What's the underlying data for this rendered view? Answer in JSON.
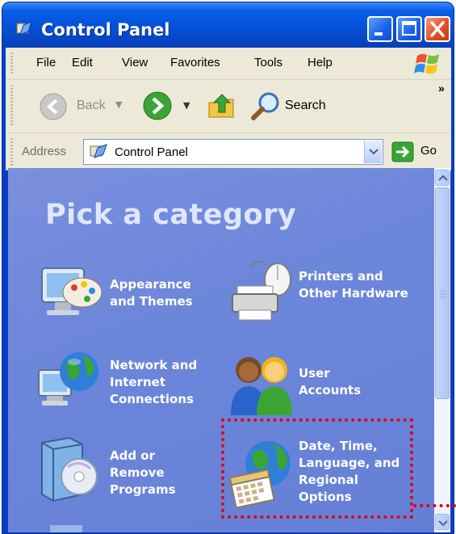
{
  "window": {
    "title": "Control Panel"
  },
  "menu": {
    "items": [
      {
        "label": "File"
      },
      {
        "label": "Edit"
      },
      {
        "label": "View"
      },
      {
        "label": "Favorites"
      },
      {
        "label": "Tools"
      },
      {
        "label": "Help"
      }
    ]
  },
  "toolbar": {
    "back_label": "Back",
    "search_label": "Search",
    "chevron": "»"
  },
  "address": {
    "label": "Address",
    "value": "Control Panel",
    "go_label": "Go"
  },
  "content": {
    "heading": "Pick a category",
    "categories": [
      {
        "label": "Appearance and Themes",
        "icon": "appearance-themes-icon"
      },
      {
        "label": "Printers and Other Hardware",
        "icon": "printer-icon"
      },
      {
        "label": "Network and Internet Connections",
        "icon": "network-globe-icon"
      },
      {
        "label": "User Accounts",
        "icon": "user-accounts-icon"
      },
      {
        "label": "Add or Remove Programs",
        "icon": "add-remove-programs-icon"
      },
      {
        "label": "Date, Time, Language, and Regional Options",
        "icon": "date-time-globe-icon"
      }
    ]
  },
  "colors": {
    "titlebar": "#0353da",
    "content_bg": "#6c86da",
    "highlight": "#e3000f"
  }
}
